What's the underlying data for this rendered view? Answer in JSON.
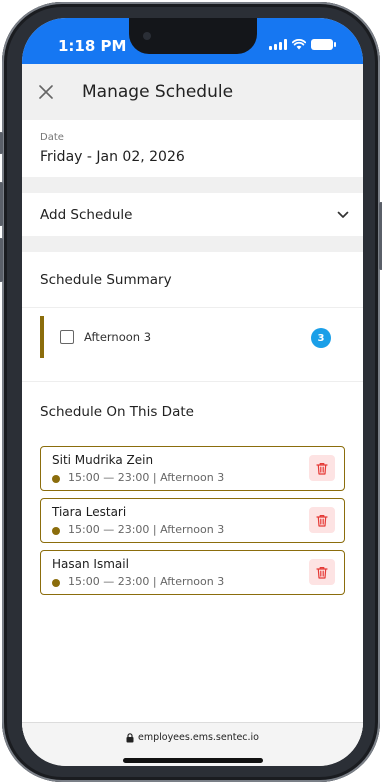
{
  "status_bar": {
    "time": "1:18 PM"
  },
  "header": {
    "title": "Manage Schedule"
  },
  "date_section": {
    "label": "Date",
    "value": "Friday - Jan 02, 2026"
  },
  "add_schedule": {
    "label": "Add Schedule"
  },
  "summary": {
    "title": "Schedule Summary",
    "items": [
      {
        "label": "Afternoon 3",
        "count": "3"
      }
    ]
  },
  "on_date": {
    "title": "Schedule On This Date",
    "items": [
      {
        "name": "Siti Mudrika Zein",
        "detail": "15:00 — 23:00 | Afternoon 3"
      },
      {
        "name": "Tiara Lestari",
        "detail": "15:00 — 23:00 | Afternoon 3"
      },
      {
        "name": "Hasan Ismail",
        "detail": "15:00 — 23:00 | Afternoon 3"
      }
    ]
  },
  "browser": {
    "url": "employees.ems.sentec.io"
  },
  "colors": {
    "accent": "#1677f2",
    "shift": "#8b6d0c",
    "badge": "#1a9fe8",
    "delete_bg": "#fde3e3",
    "delete_icon": "#e53935"
  },
  "icons": {
    "close": "close-icon",
    "chevron": "chevron-down-icon",
    "delete": "trash-icon",
    "lock": "lock-icon"
  }
}
